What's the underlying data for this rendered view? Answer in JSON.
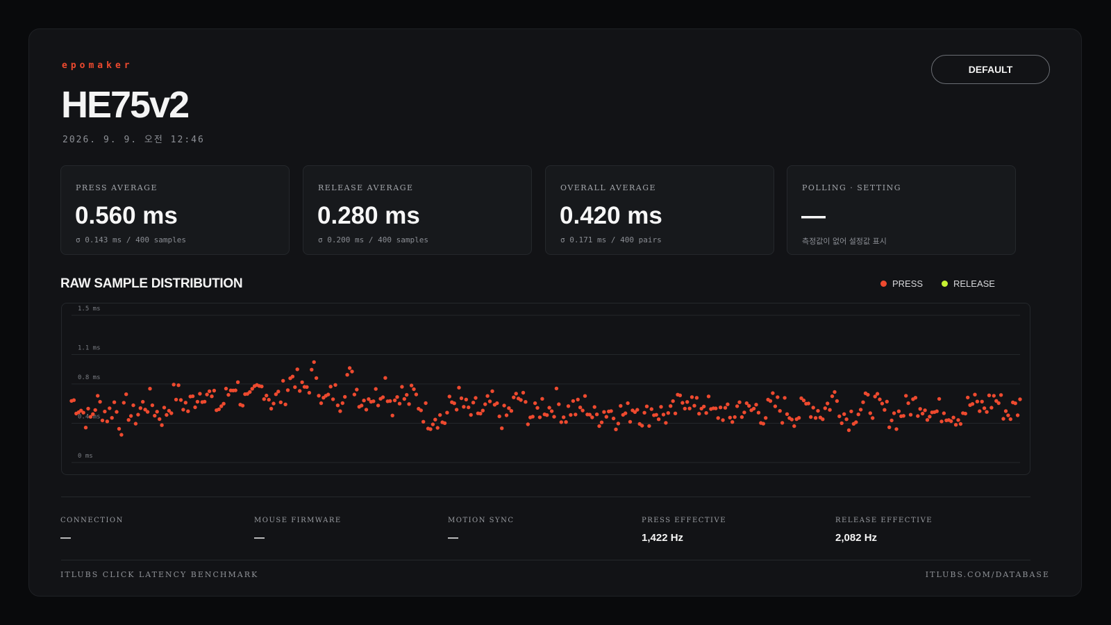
{
  "header": {
    "brand": "epomaker",
    "model": "HE75v2",
    "date": "2026. 9. 9. 오전 12:46",
    "default_button": "DEFAULT"
  },
  "stats": [
    {
      "label": "PRESS AVERAGE",
      "value": "0.560 ms",
      "sub": "σ 0.143 ms / 400 samples"
    },
    {
      "label": "RELEASE AVERAGE",
      "value": "0.280 ms",
      "sub": "σ 0.200 ms / 400 samples"
    },
    {
      "label": "OVERALL AVERAGE",
      "value": "0.420 ms",
      "sub": "σ 0.171 ms / 400 pairs"
    },
    {
      "label": "POLLING · SETTING",
      "value": "—",
      "sub": "측정값이 없어 설정값 표시"
    }
  ],
  "chart": {
    "title": "RAW SAMPLE DISTRIBUTION",
    "legend": [
      {
        "label": "PRESS",
        "color": "#ee4a2f"
      },
      {
        "label": "RELEASE",
        "color": "#c6f032"
      }
    ]
  },
  "chart_data": {
    "type": "scatter",
    "title": "RAW SAMPLE DISTRIBUTION",
    "ylabel": "",
    "ylim": [
      0,
      1.5
    ],
    "yticks": [
      "1.5 ms",
      "1.1 ms",
      "0.8 ms",
      "0.4 ms",
      "0 ms"
    ],
    "ytick_values": [
      1.5,
      1.1,
      0.8,
      0.4,
      0
    ],
    "grid": true,
    "legend_position": "top-right",
    "series": [
      {
        "name": "PRESS",
        "color": "#ee4a2f",
        "x_range": [
          1,
          400
        ],
        "approx_values_by_segment": [
          {
            "x": [
              1,
              50
            ],
            "values": [
              0.63,
              0.6,
              0.5,
              0.42,
              0.62,
              0.55,
              0.48,
              0.6,
              0.38,
              0.58,
              0.45,
              0.52,
              0.6,
              0.62,
              0.5,
              0.47,
              0.58,
              0.72,
              0.63,
              0.55
            ]
          },
          {
            "x": [
              51,
              110
            ],
            "values": [
              0.6,
              0.7,
              0.75,
              0.62,
              0.55,
              0.68,
              0.83,
              0.65,
              0.58,
              0.72,
              0.78,
              0.62,
              0.66,
              0.74,
              0.92,
              0.7,
              0.8,
              0.95,
              0.6,
              0.67
            ]
          },
          {
            "x": [
              111,
              170
            ],
            "values": [
              0.72,
              0.65,
              0.9,
              0.78,
              0.62,
              0.7,
              0.66,
              0.85,
              0.58,
              0.74,
              0.62,
              0.69,
              0.56,
              0.45,
              0.5,
              0.41,
              0.6,
              0.66,
              0.53,
              0.48
            ]
          },
          {
            "x": [
              171,
              230
            ],
            "values": [
              0.55,
              0.47,
              0.62,
              0.5,
              0.44,
              0.58,
              0.67,
              0.52,
              0.46,
              0.6,
              0.55,
              0.63,
              0.48,
              0.57,
              0.52,
              0.6,
              0.45,
              0.5,
              0.55,
              0.47
            ]
          },
          {
            "x": [
              231,
              300
            ],
            "values": [
              0.52,
              0.48,
              0.6,
              0.44,
              0.55,
              0.5,
              0.46,
              0.58,
              0.7,
              0.52,
              0.63,
              0.47,
              0.55,
              0.42,
              0.6,
              0.5,
              0.56,
              0.48,
              0.6,
              0.52
            ]
          },
          {
            "x": [
              301,
              400
            ],
            "values": [
              0.55,
              0.48,
              0.6,
              0.5,
              0.68,
              0.45,
              0.55,
              0.6,
              0.52,
              0.46,
              0.58,
              0.62,
              0.5,
              0.55,
              0.48,
              0.6,
              0.55,
              0.66,
              0.5,
              0.58
            ]
          }
        ]
      },
      {
        "name": "RELEASE",
        "color": "#c6f032",
        "values": []
      }
    ]
  },
  "meta": [
    {
      "label": "CONNECTION",
      "value": "—"
    },
    {
      "label": "MOUSE FIRMWARE",
      "value": "—"
    },
    {
      "label": "MOTION SYNC",
      "value": "—"
    },
    {
      "label": "PRESS EFFECTIVE",
      "value": "1,422 Hz"
    },
    {
      "label": "RELEASE EFFECTIVE",
      "value": "2,082 Hz"
    }
  ],
  "footer": {
    "left": "ITLUBS CLICK LATENCY BENCHMARK",
    "right": "ITLUBS.COM/DATABASE"
  }
}
